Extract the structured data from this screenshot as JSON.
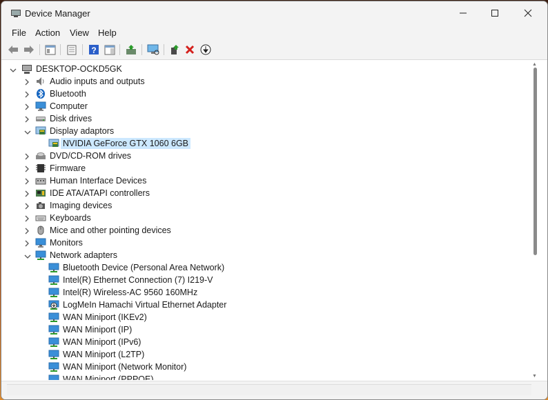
{
  "window": {
    "title": "Device Manager"
  },
  "menu": [
    "File",
    "Action",
    "View",
    "Help"
  ],
  "tree": {
    "root": "DESKTOP-OCKD5GK",
    "items": [
      {
        "label": "Audio inputs and outputs",
        "icon": "speaker-icon",
        "expanded": false
      },
      {
        "label": "Bluetooth",
        "icon": "bluetooth-icon",
        "expanded": false
      },
      {
        "label": "Computer",
        "icon": "monitor-icon",
        "expanded": false
      },
      {
        "label": "Disk drives",
        "icon": "disk-drive-icon",
        "expanded": false
      },
      {
        "label": "Display adaptors",
        "icon": "display-adapter-icon",
        "expanded": true,
        "children": [
          {
            "label": "NVIDIA GeForce GTX 1060 6GB",
            "icon": "display-adapter-icon",
            "selected": true
          }
        ]
      },
      {
        "label": "DVD/CD-ROM drives",
        "icon": "optical-drive-icon",
        "expanded": false
      },
      {
        "label": "Firmware",
        "icon": "firmware-chip-icon",
        "expanded": false
      },
      {
        "label": "Human Interface Devices",
        "icon": "hid-icon",
        "expanded": false
      },
      {
        "label": "IDE ATA/ATAPI controllers",
        "icon": "ide-controller-icon",
        "expanded": false
      },
      {
        "label": "Imaging devices",
        "icon": "camera-icon",
        "expanded": false
      },
      {
        "label": "Keyboards",
        "icon": "keyboard-icon",
        "expanded": false
      },
      {
        "label": "Mice and other pointing devices",
        "icon": "mouse-icon",
        "expanded": false
      },
      {
        "label": "Monitors",
        "icon": "monitor-icon",
        "expanded": false
      },
      {
        "label": "Network adapters",
        "icon": "network-adapter-icon",
        "expanded": true,
        "children": [
          {
            "label": "Bluetooth Device (Personal Area Network)",
            "icon": "network-adapter-icon"
          },
          {
            "label": "Intel(R) Ethernet Connection (7) I219-V",
            "icon": "network-adapter-icon"
          },
          {
            "label": "Intel(R) Wireless-AC 9560 160MHz",
            "icon": "network-adapter-icon"
          },
          {
            "label": "LogMeIn Hamachi Virtual Ethernet Adapter",
            "icon": "network-adapter-warning-icon"
          },
          {
            "label": "WAN Miniport (IKEv2)",
            "icon": "network-adapter-icon"
          },
          {
            "label": "WAN Miniport (IP)",
            "icon": "network-adapter-icon"
          },
          {
            "label": "WAN Miniport (IPv6)",
            "icon": "network-adapter-icon"
          },
          {
            "label": "WAN Miniport (L2TP)",
            "icon": "network-adapter-icon"
          },
          {
            "label": "WAN Miniport (Network Monitor)",
            "icon": "network-adapter-icon"
          },
          {
            "label": "WAN Miniport (PPPOE)",
            "icon": "network-adapter-icon"
          }
        ]
      }
    ]
  }
}
